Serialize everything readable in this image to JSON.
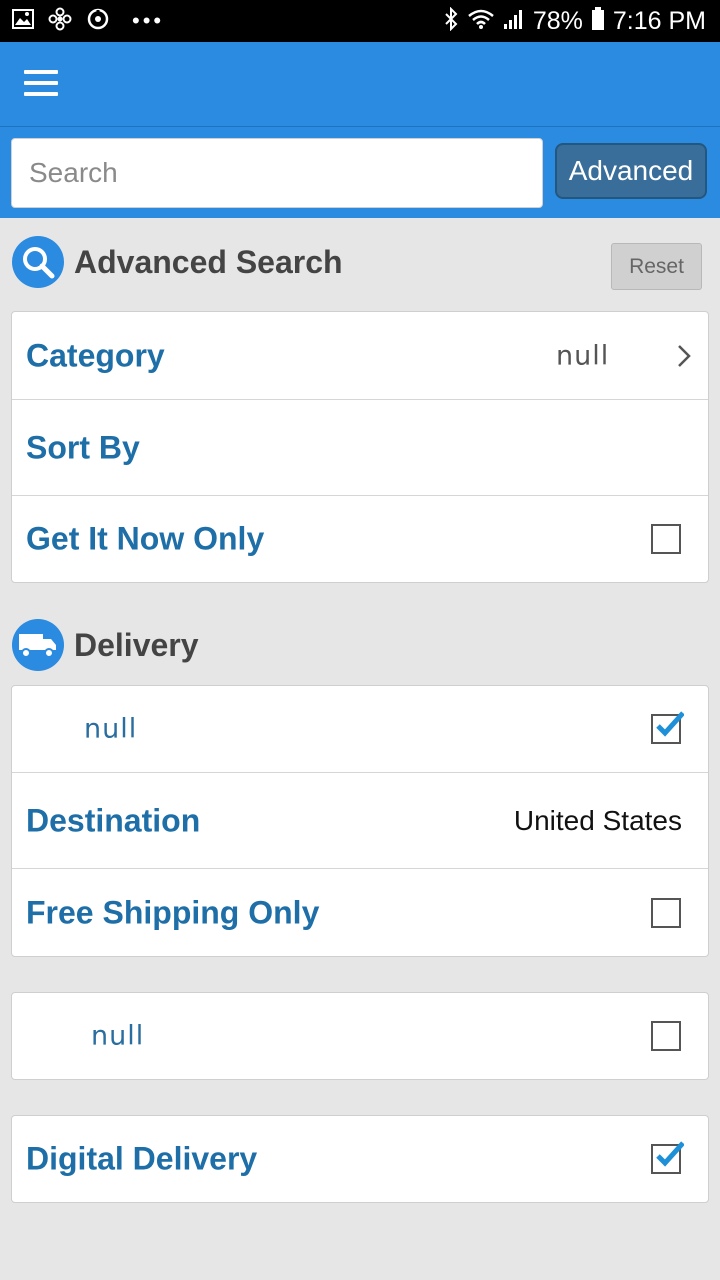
{
  "status_bar": {
    "battery": "78%",
    "time": "7:16 PM",
    "left_icons": [
      "image-icon",
      "fan-icon",
      "sync-icon"
    ],
    "overflow": "•••"
  },
  "app_bar": {
    "menu_icon": "hamburger-menu-icon"
  },
  "search": {
    "placeholder": "Search",
    "value": "",
    "advanced_label": "Advanced"
  },
  "advanced_section": {
    "title": "Advanced Search",
    "icon": "search-icon",
    "reset_label": "Reset",
    "rows": {
      "category": {
        "label": "Category",
        "value": "null"
      },
      "sort_by": {
        "label": "Sort By"
      },
      "get_it_now": {
        "label": "Get It Now Only",
        "checked": false
      }
    }
  },
  "delivery_section": {
    "title": "Delivery",
    "icon": "truck-icon",
    "rows": {
      "option_null": {
        "label": "null",
        "checked": true
      },
      "destination": {
        "label": "Destination",
        "value": "United States"
      },
      "free_shipping": {
        "label": "Free Shipping Only",
        "checked": false
      }
    }
  },
  "extra_option": {
    "label": "null",
    "checked": false
  },
  "digital_delivery": {
    "label": "Digital Delivery",
    "checked": true
  },
  "colors": {
    "primary": "#2b8be0",
    "label_blue": "#1e6ea8",
    "check_blue": "#1e90d8",
    "background": "#e6e6e6"
  }
}
